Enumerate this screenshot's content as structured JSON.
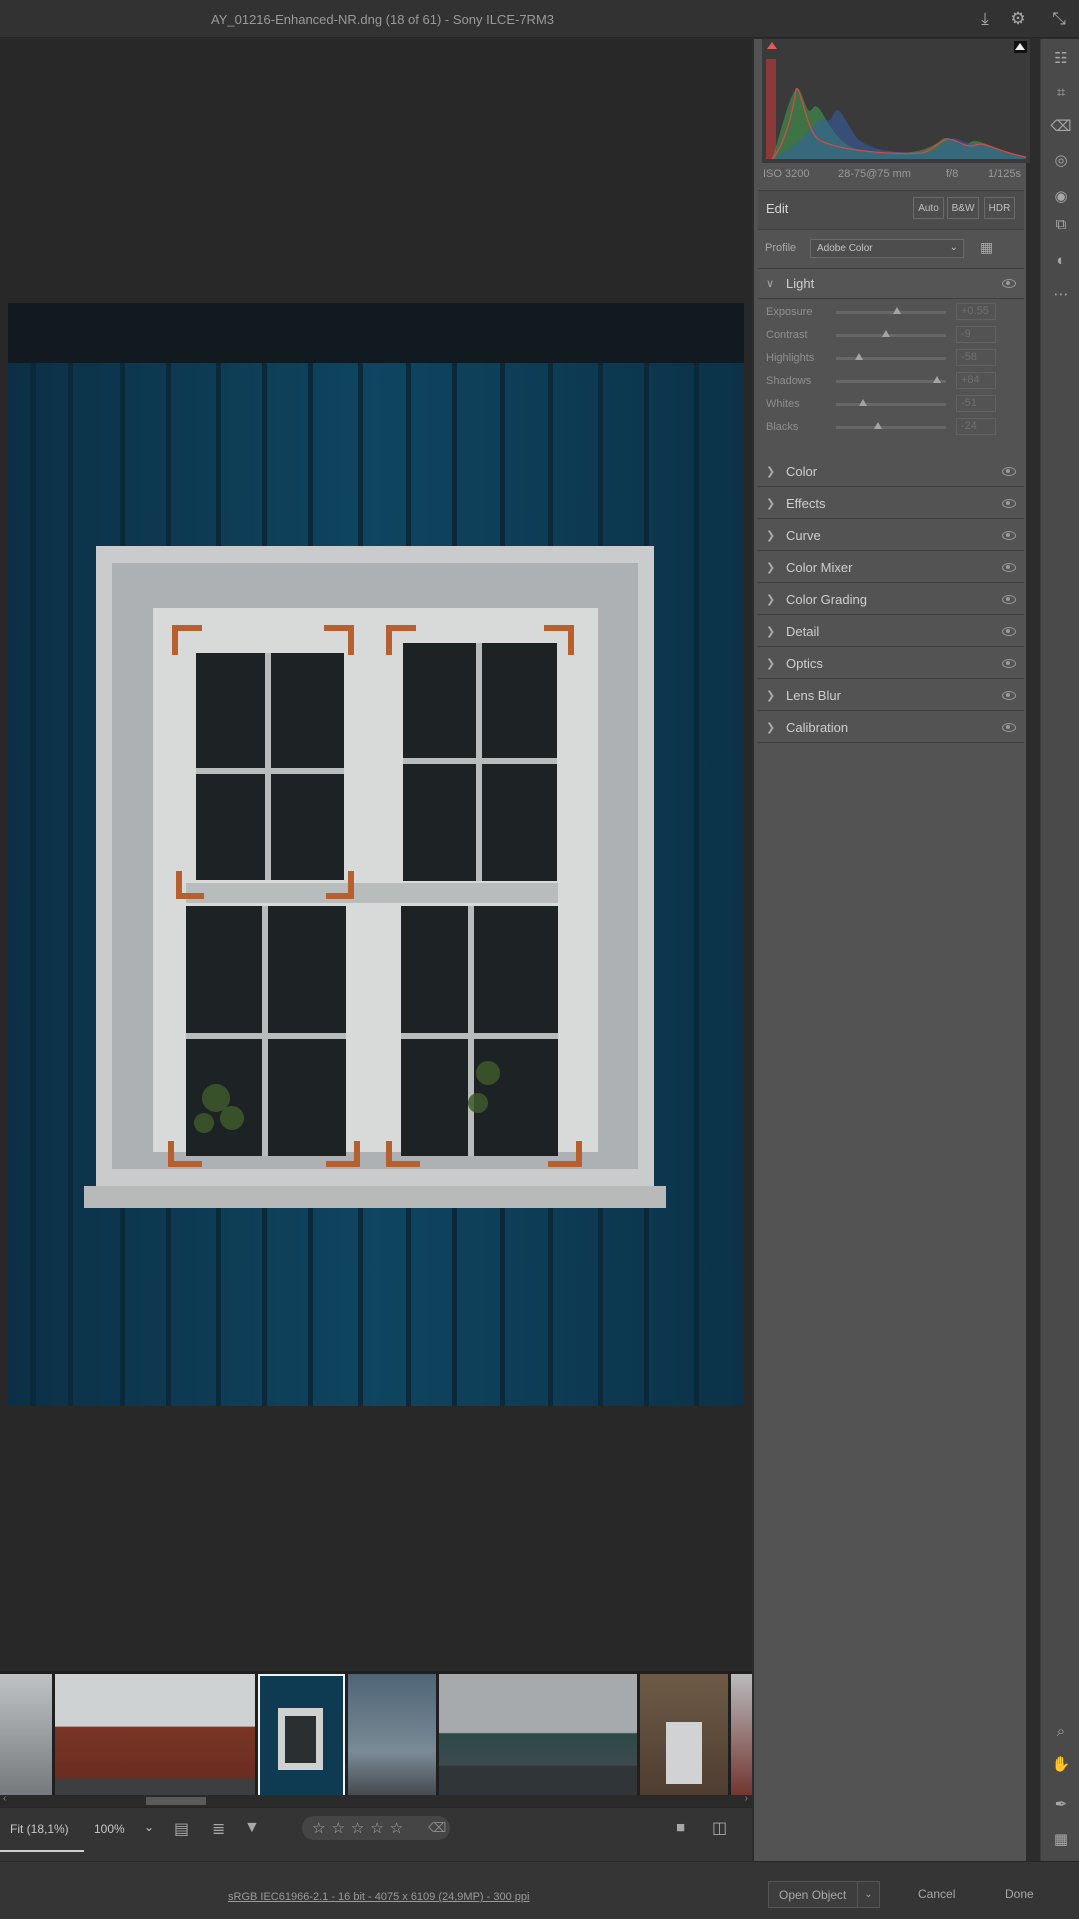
{
  "window": {
    "title": "AY_01216-Enhanced-NR.dng (18 of 61)  -  Sony ILCE-7RM3"
  },
  "histogram": {
    "iso": "ISO 3200",
    "lens": "28-75@75 mm",
    "aperture": "f/8",
    "shutter": "1/125s"
  },
  "edit": {
    "title": "Edit",
    "auto_label": "Auto",
    "bw_label": "B&W",
    "hdr_label": "HDR",
    "profile_label": "Profile",
    "profile_value": "Adobe Color"
  },
  "light": {
    "title": "Light",
    "sliders": [
      {
        "label": "Exposure",
        "value": "+0.55",
        "pos": 0.55
      },
      {
        "label": "Contrast",
        "value": "-9",
        "pos": 0.455
      },
      {
        "label": "Highlights",
        "value": "-58",
        "pos": 0.21
      },
      {
        "label": "Shadows",
        "value": "+84",
        "pos": 0.92
      },
      {
        "label": "Whites",
        "value": "-51",
        "pos": 0.245
      },
      {
        "label": "Blacks",
        "value": "-24",
        "pos": 0.38
      }
    ]
  },
  "sections": [
    "Color",
    "Effects",
    "Curve",
    "Color Mixer",
    "Color Grading",
    "Detail",
    "Optics",
    "Lens Blur",
    "Calibration"
  ],
  "bottom": {
    "zoom_fit": "Fit (18,1%)",
    "zoom_100": "100%"
  },
  "status": {
    "file_info": "sRGB IEC61966-2.1 - 16 bit - 4075 x 6109 (24,9MP) - 300 ppi",
    "open_label": "Open Object",
    "cancel_label": "Cancel",
    "done_label": "Done"
  },
  "colors": {
    "accent_blue": "#0e3a52",
    "panel_bg": "#535353",
    "app_bg": "#2c2c2c"
  }
}
